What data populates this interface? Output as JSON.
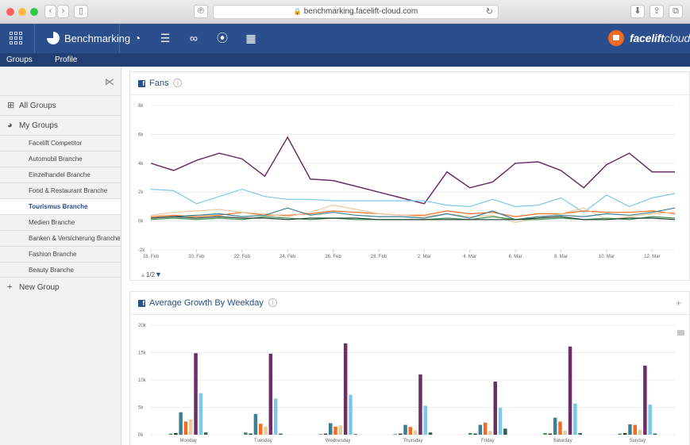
{
  "browser": {
    "url": "benchmarking.facelift-cloud.com",
    "traffic_lights": [
      "#fc605c",
      "#fdbc40",
      "#34c84a"
    ]
  },
  "app": {
    "brand": "Benchmarking",
    "logo_main": "facelift",
    "logo_suffix": "cloud",
    "nav_icons": [
      "dashboard-icon",
      "stack-icon",
      "binoculars-icon",
      "facebook-search-icon",
      "calendar-icon"
    ],
    "subnav": [
      "Groups",
      "Profile"
    ],
    "colors": {
      "header": "#2a4f8c",
      "subnav": "#213f72",
      "accent": "#f16a22"
    }
  },
  "sidebar": {
    "all_groups": "All Groups",
    "my_groups": "My Groups",
    "groups": [
      "Facelift Competitor",
      "Automobil Branche",
      "Einzelhandel Branche",
      "Food & Restaurant Branche",
      "Tourismus Branche",
      "Medien Branche",
      "Banken & Versicherung Branche",
      "Fashion Branche",
      "Beauty Branche"
    ],
    "active_group": "Tourismus Branche",
    "new_group": "New Group"
  },
  "fans_panel": {
    "title": "Fans",
    "info": "i",
    "pager": "1/2"
  },
  "growth_panel": {
    "title": "Average Growth By Weekday",
    "info": "i",
    "add": "+"
  },
  "chart_data": [
    {
      "type": "line",
      "title": "Fans",
      "x": [
        "18. Feb",
        "19. Feb",
        "20. Feb",
        "21. Feb",
        "22. Feb",
        "23. Feb",
        "24. Feb",
        "25. Feb",
        "26. Feb",
        "27. Feb",
        "28. Feb",
        "1. Mar",
        "2. Mar",
        "3. Mar",
        "4. Mar",
        "5. Mar",
        "6. Mar",
        "7. Mar",
        "8. Mar",
        "9. Mar",
        "10. Mar",
        "11. Mar",
        "12. Mar",
        "13. Mar"
      ],
      "x_tick_labels": [
        "18. Feb",
        "20. Feb",
        "22. Feb",
        "24. Feb",
        "26. Feb",
        "28. Feb",
        "2. Mar",
        "4. Mar",
        "6. Mar",
        "8. Mar",
        "10. Mar",
        "12. Mar"
      ],
      "y_tick_labels": [
        "-2k",
        "0k",
        "2k",
        "4k",
        "6k",
        "8k"
      ],
      "ylim": [
        -2000,
        8000
      ],
      "grid": true,
      "series": [
        {
          "color": "#6b2f66",
          "values": [
            4000,
            3500,
            4200,
            4700,
            4300,
            3100,
            5800,
            2900,
            2800,
            2400,
            2000,
            1600,
            1200,
            3400,
            2300,
            2700,
            4000,
            4100,
            3500,
            2300,
            3900,
            4700,
            3400,
            3400
          ]
        },
        {
          "color": "#7cc8e8",
          "values": [
            2200,
            2100,
            1200,
            1700,
            2200,
            1700,
            1500,
            1500,
            1400,
            1400,
            1400,
            1400,
            1400,
            1100,
            1000,
            1500,
            1000,
            1100,
            1600,
            600,
            1800,
            1000,
            1600,
            1900
          ]
        },
        {
          "color": "#f26d22",
          "values": [
            300,
            400,
            300,
            400,
            600,
            400,
            400,
            500,
            700,
            600,
            500,
            400,
            400,
            700,
            500,
            600,
            300,
            500,
            500,
            700,
            600,
            600,
            700,
            500
          ]
        },
        {
          "color": "#e8c9a0",
          "values": [
            400,
            600,
            700,
            800,
            600,
            500,
            300,
            600,
            1100,
            800,
            500,
            400,
            300,
            500,
            300,
            400,
            -100,
            200,
            500,
            900,
            100,
            300,
            500,
            600
          ]
        },
        {
          "color": "#3d7f92",
          "values": [
            200,
            300,
            400,
            500,
            300,
            400,
            900,
            400,
            600,
            400,
            300,
            300,
            200,
            500,
            200,
            700,
            100,
            300,
            400,
            300,
            500,
            400,
            600,
            900
          ]
        },
        {
          "color": "#3c8f4e",
          "values": [
            100,
            200,
            100,
            200,
            100,
            300,
            200,
            100,
            200,
            100,
            100,
            100,
            100,
            200,
            100,
            300,
            100,
            100,
            200,
            100,
            200,
            100,
            300,
            200
          ]
        },
        {
          "color": "#1f3f2f",
          "values": [
            200,
            300,
            200,
            300,
            200,
            200,
            100,
            200,
            200,
            200,
            100,
            100,
            100,
            100,
            100,
            100,
            100,
            200,
            300,
            100,
            100,
            200,
            200,
            100
          ]
        }
      ]
    },
    {
      "type": "bar",
      "title": "Average Growth By Weekday",
      "categories": [
        "Monday",
        "Tuesday",
        "Wednesday",
        "Thursday",
        "Friday",
        "Saturday",
        "Sunday"
      ],
      "y_tick_labels": [
        "0k",
        "5k",
        "10k",
        "15k",
        "20k"
      ],
      "ylim": [
        0,
        20000
      ],
      "grid": true,
      "series": [
        {
          "color": "#3c8f4e",
          "values": [
            200,
            400,
            100,
            100,
            300,
            300,
            200
          ]
        },
        {
          "color": "#1f3f2f",
          "values": [
            300,
            200,
            200,
            200,
            200,
            200,
            300
          ]
        },
        {
          "color": "#3d7f92",
          "values": [
            4100,
            3800,
            2100,
            1800,
            1800,
            3100,
            1900
          ]
        },
        {
          "color": "#f26d22",
          "values": [
            2400,
            2000,
            1500,
            1400,
            2200,
            2400,
            1800
          ]
        },
        {
          "color": "#e8c9a0",
          "values": [
            2800,
            1500,
            1700,
            800,
            700,
            700,
            900
          ]
        },
        {
          "color": "#6b2f66",
          "values": [
            14900,
            14800,
            16700,
            11000,
            9700,
            16100,
            12600
          ]
        },
        {
          "color": "#7cc8e8",
          "values": [
            7600,
            6600,
            7300,
            5300,
            4900,
            5700,
            5500
          ]
        },
        {
          "color": "#2e5e55",
          "values": [
            400,
            200,
            100,
            400,
            1100,
            300,
            200
          ]
        }
      ]
    }
  ]
}
